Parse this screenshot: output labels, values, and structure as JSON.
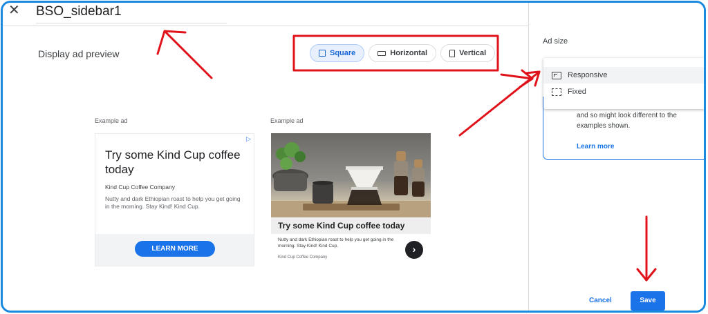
{
  "header": {
    "close_icon": "close-icon",
    "title_value": "BSO_sidebar1"
  },
  "main": {
    "preview_title": "Display ad preview",
    "format_chips": [
      {
        "label": "Square",
        "icon": "square-icon",
        "selected": true
      },
      {
        "label": "Horizontal",
        "icon": "horizontal-rect-icon",
        "selected": false
      },
      {
        "label": "Vertical",
        "icon": "vertical-rect-icon",
        "selected": false
      }
    ],
    "example_label": "Example ad",
    "ad1": {
      "headline": "Try some Kind Cup coffee today",
      "company": "Kind Cup Coffee Company",
      "description": "Nutty and dark Ethiopian roast to help you get going in the morning. Stay Kind! Kind Cup.",
      "cta": "LEARN MORE",
      "adchoices_icon": "▷"
    },
    "ad2": {
      "headline": "Try some Kind Cup coffee today",
      "description": "Nutty and dark Ethiopian roast to help you get going in the morning. Stay Kind! Kind Cup.",
      "company": "Kind Cup Coffee Company",
      "arrow": "›"
    }
  },
  "panel": {
    "heading": "Ad size",
    "menu_items": [
      {
        "label": "Responsive",
        "icon": "responsive-icon",
        "selected": true
      },
      {
        "label": "Fixed",
        "icon": "fixed-icon",
        "selected": false
      }
    ],
    "info_text": "and so might look different to the examples shown.",
    "learn_more": "Learn more",
    "cancel": "Cancel",
    "save": "Save"
  },
  "colors": {
    "accent": "#1a73e8",
    "annotation": "#e0121a",
    "frame": "#1a8ae0"
  }
}
